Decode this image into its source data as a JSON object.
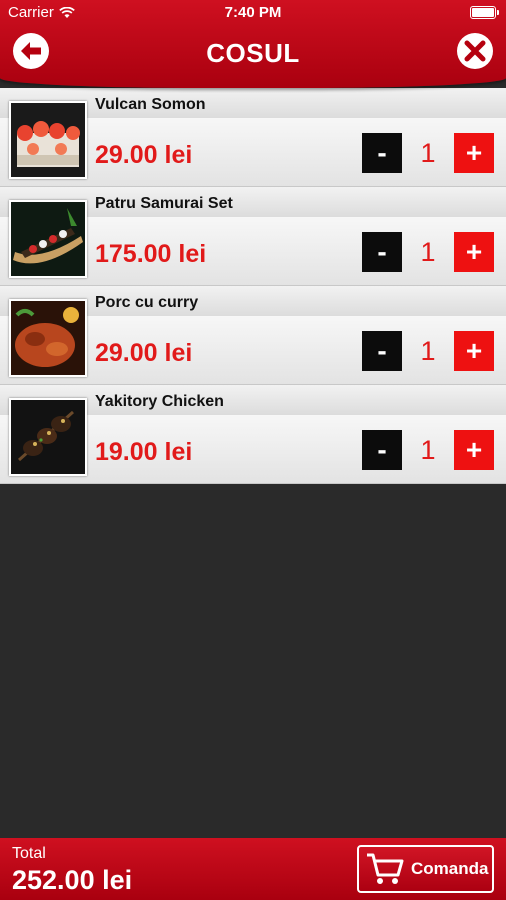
{
  "status": {
    "carrier": "Carrier",
    "time": "7:40 PM"
  },
  "header": {
    "title": "COSUL",
    "back_icon": "arrow-left-icon",
    "close_icon": "close-icon"
  },
  "cart": {
    "minus_label": "-",
    "plus_label": "+",
    "items": [
      {
        "name": "Vulcan Somon",
        "price": "29.00 lei",
        "qty": "1"
      },
      {
        "name": "Patru Samurai Set",
        "price": "175.00 lei",
        "qty": "1"
      },
      {
        "name": "Porc cu curry",
        "price": "29.00 lei",
        "qty": "1"
      },
      {
        "name": "Yakitory Chicken",
        "price": "19.00 lei",
        "qty": "1"
      }
    ]
  },
  "footer": {
    "total_label": "Total",
    "total_value": "252.00 lei",
    "order_label": "Comanda",
    "order_icon": "cart-icon"
  },
  "colors": {
    "brand_red": "#c0081a",
    "price_red": "#e11a1a",
    "minus_black": "#0c0c0c",
    "plus_red": "#ee1111"
  }
}
